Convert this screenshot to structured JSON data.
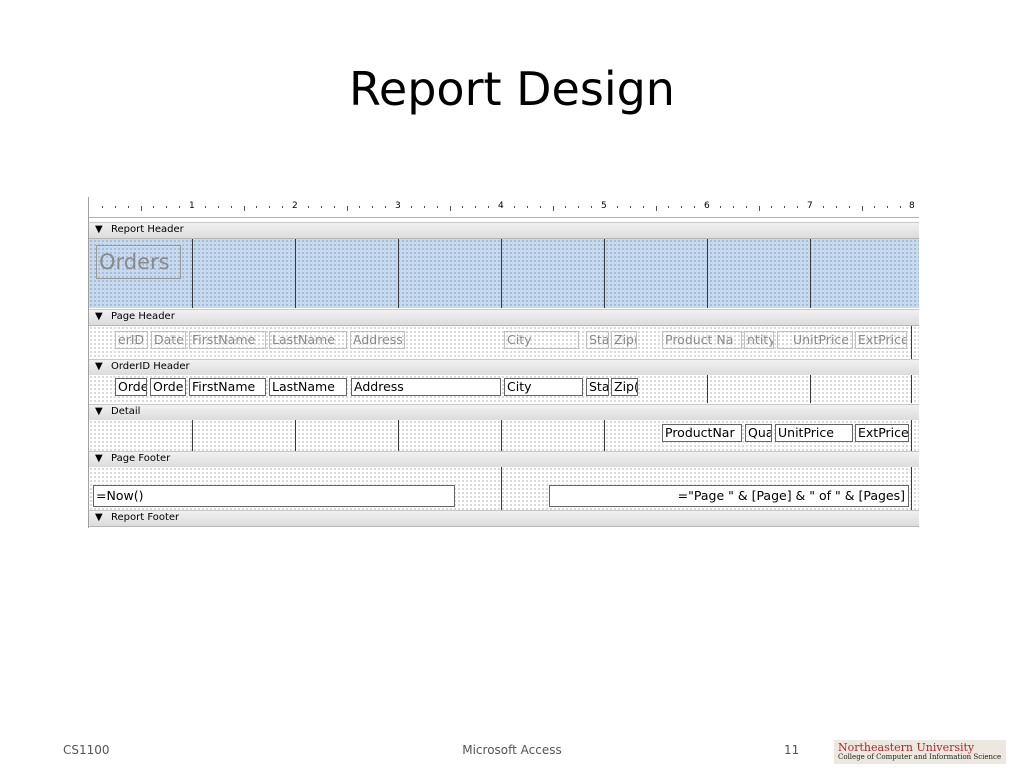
{
  "slide": {
    "title": "Report Design",
    "footer": {
      "course": "CS1100",
      "center": "Microsoft Access",
      "page": "11"
    },
    "logo": {
      "name": "Northeastern University",
      "subtitle": "College of Computer and Information Science"
    }
  },
  "ruler": {
    "numbers": [
      "1",
      "2",
      "3",
      "4",
      "5",
      "6",
      "7",
      "8"
    ]
  },
  "sections": {
    "report_header": "Report Header",
    "page_header": "Page Header",
    "orderid_header": "OrderID Header",
    "detail": "Detail",
    "page_footer": "Page Footer",
    "report_footer": "Report Footer"
  },
  "report_header": {
    "title_label": "Orders"
  },
  "page_header": {
    "labels": [
      "erID",
      "Date",
      "FirstName",
      "LastName",
      "Address",
      "City",
      "Sta",
      "Zip(",
      "Product Na",
      "ntity",
      "UnitPrice",
      "ExtPrice"
    ]
  },
  "orderid_header": {
    "fields": [
      "Orde",
      "Orde",
      "FirstName",
      "LastName",
      "Address",
      "City",
      "Sta",
      "Zip("
    ]
  },
  "detail": {
    "fields": [
      "ProductNar",
      "Qua",
      "UnitPrice",
      "ExtPrice"
    ]
  },
  "page_footer": {
    "now_expr": "=Now()",
    "page_expr": "=\"Page \" & [Page] & \" of \" & [Pages]"
  },
  "colors": {
    "selected_band": "#c6d9ef",
    "section_bar": "#dcdcdc"
  }
}
